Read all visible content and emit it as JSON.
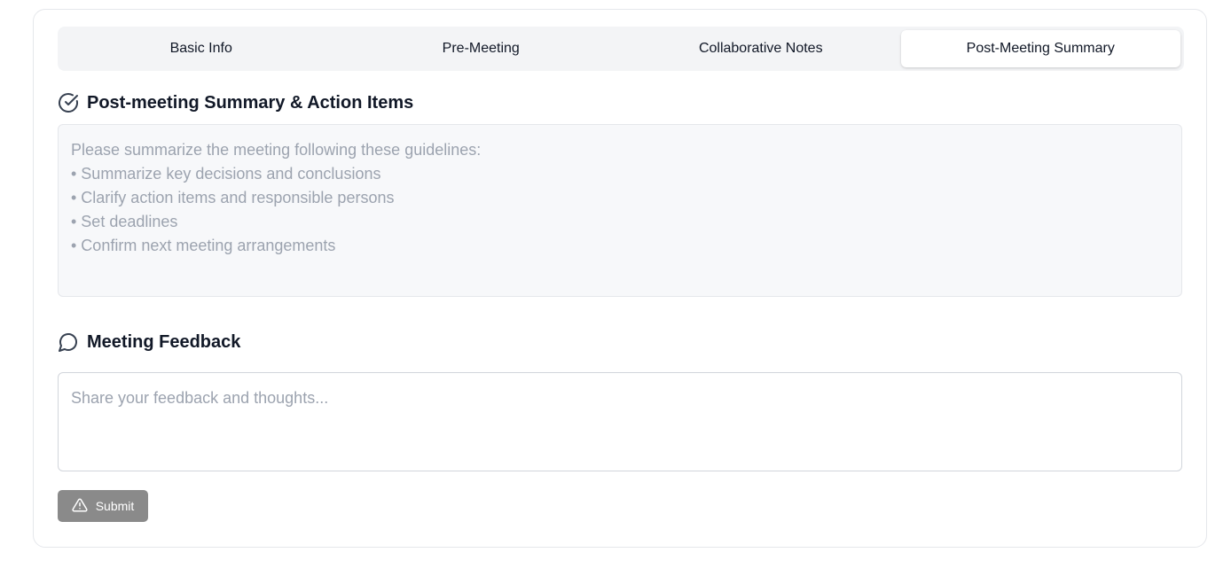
{
  "tabs": [
    {
      "label": "Basic Info",
      "active": false
    },
    {
      "label": "Pre-Meeting",
      "active": false
    },
    {
      "label": "Collaborative Notes",
      "active": false
    },
    {
      "label": "Post-Meeting Summary",
      "active": true
    }
  ],
  "summary": {
    "title": "Post-meeting Summary & Action Items",
    "icon": "check-circle-icon",
    "placeholder_lines": [
      "Please summarize the meeting following these guidelines:",
      "• Summarize key decisions and conclusions",
      "• Clarify action items and responsible persons",
      "• Set deadlines",
      "• Confirm next meeting arrangements"
    ]
  },
  "feedback": {
    "title": "Meeting Feedback",
    "icon": "message-circle-icon",
    "placeholder": "Share your feedback and thoughts..."
  },
  "submit": {
    "label": "Submit",
    "icon": "warning-triangle-icon",
    "color": "#8a8a8a"
  }
}
